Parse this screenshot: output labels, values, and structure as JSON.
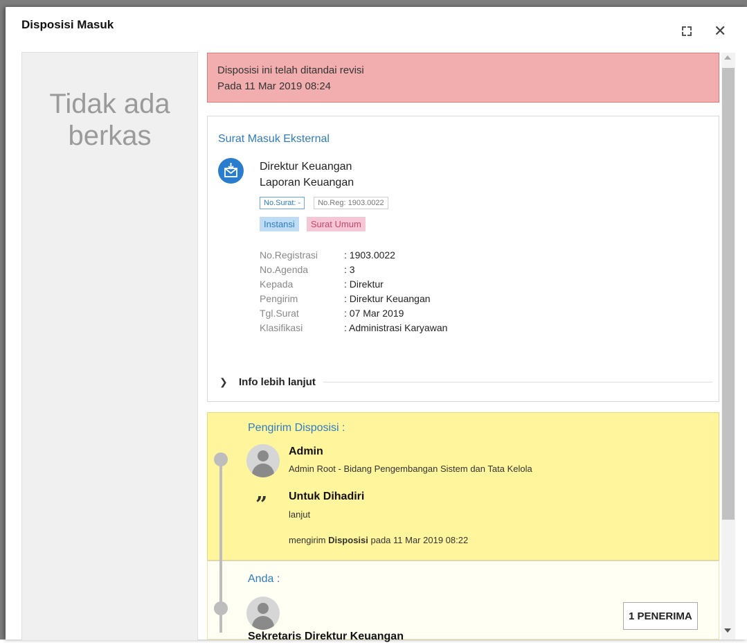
{
  "dialog": {
    "title": "Disposisi Masuk"
  },
  "left_panel": {
    "empty_line1": "Tidak ada",
    "empty_line2": "berkas"
  },
  "alert": {
    "line1": "Disposisi ini telah ditandai revisi",
    "line2": "Pada 11 Mar 2019 08:24",
    "color": "#f2aeaf"
  },
  "letter": {
    "type_label": "Surat Masuk Eksternal",
    "sender": "Direktur Keuangan",
    "subject": "Laporan Keuangan",
    "no_surat_tag": "No.Surat: -",
    "no_reg_tag": "No.Reg: 1903.0022",
    "tags": [
      "Instansi",
      "Surat Umum"
    ],
    "details": [
      {
        "label": "No.Registrasi",
        "value": ": 1903.0022"
      },
      {
        "label": "No.Agenda",
        "value": ": 3"
      },
      {
        "label": "Kepada",
        "value": ": Direktur"
      },
      {
        "label": "Pengirim",
        "value": ": Direktur Keuangan"
      },
      {
        "label": "Tgl.Surat",
        "value": ": 07 Mar 2019"
      },
      {
        "label": "Klasifikasi",
        "value": ": Administrasi Karyawan"
      }
    ],
    "more_info": "Info lebih lanjut",
    "icon_color": "#2a7ccc"
  },
  "disposition": {
    "sender_label": "Pengirim Disposisi :",
    "sender_name": "Admin",
    "sender_role": "Admin Root - Bidang Pengembangan Sistem dan Tata Kelola",
    "instruction_title": "Untuk Dihadiri",
    "instruction_note": "lanjut",
    "sent_prefix": "mengirim ",
    "sent_bold": "Disposisi",
    "sent_suffix": " pada 11 Mar 2019 08:22",
    "highlight_color": "#fff59d"
  },
  "recipient": {
    "label": "Anda :",
    "receivers_button": "1 PENERIMA",
    "name": "Sekretaris Direktur Keuangan"
  }
}
